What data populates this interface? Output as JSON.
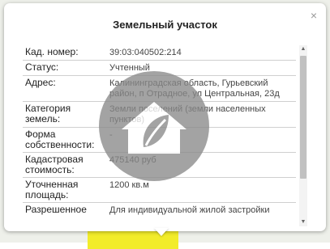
{
  "popup": {
    "title": "Земельный участок",
    "close_symbol": "×",
    "rows": [
      {
        "label": "Кад. номер:",
        "value": "39:03:040502:214"
      },
      {
        "label": "Статус:",
        "value": "Учтенный"
      },
      {
        "label": "Адрес:",
        "value": "Калининградская область, Гурьевский район, п Отрадное, ул Центральная, 23д"
      },
      {
        "label": "Категория земель:",
        "value": "Земли поселений (земли населенных пунктов)"
      },
      {
        "label": "Форма собственности:",
        "value": "-"
      },
      {
        "label": "Кадастровая стоимость:",
        "value": "475140 руб"
      },
      {
        "label": "Уточненная площадь:",
        "value": "1200 кв.м"
      },
      {
        "label": "Разрешенное",
        "value": "Для индивидуальной жилой застройки"
      }
    ]
  },
  "scrollbar": {
    "up_symbol": "▲",
    "down_symbol": "▼"
  },
  "watermark": {
    "icon": "house-leaf-icon"
  },
  "colors": {
    "map_yellow": "#f2ec2a",
    "watermark_gray": "#8a8a8a"
  }
}
